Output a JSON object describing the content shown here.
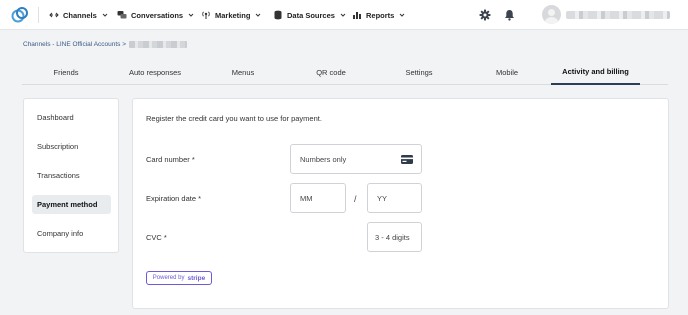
{
  "nav": {
    "items": [
      {
        "label": "Channels",
        "icon": "link-icon"
      },
      {
        "label": "Conversations",
        "icon": "chat-bubbles-icon"
      },
      {
        "label": "Marketing",
        "icon": "broadcast-icon"
      },
      {
        "label": "Data Sources",
        "icon": "database-icon"
      },
      {
        "label": "Reports",
        "icon": "bar-chart-icon"
      }
    ],
    "user_name": "████████"
  },
  "breadcrumb": {
    "text": "Channels - LINE Official Accounts >"
  },
  "tabs": [
    {
      "label": "Friends"
    },
    {
      "label": "Auto responses"
    },
    {
      "label": "Menus"
    },
    {
      "label": "QR code"
    },
    {
      "label": "Settings"
    },
    {
      "label": "Mobile"
    },
    {
      "label": "Activity and billing",
      "active": true
    }
  ],
  "sidebar": {
    "items": [
      {
        "label": "Dashboard"
      },
      {
        "label": "Subscription"
      },
      {
        "label": "Transactions"
      },
      {
        "label": "Payment method",
        "active": true
      },
      {
        "label": "Company info"
      }
    ]
  },
  "payment": {
    "intro": "Register the credit card you want to use for payment.",
    "card_number_label": "Card number *",
    "card_number_placeholder": "Numbers only",
    "expiration_label": "Expiration date *",
    "month_placeholder": "MM",
    "separator": "/",
    "year_placeholder": "YY",
    "cvc_label": "CVC *",
    "cvc_placeholder": "3 - 4 digits",
    "powered_by": "Powered by",
    "stripe": "stripe"
  },
  "colors": {
    "accent": "#2c3e57",
    "link": "#3a5a86",
    "stripe": "#6b5bd6"
  }
}
